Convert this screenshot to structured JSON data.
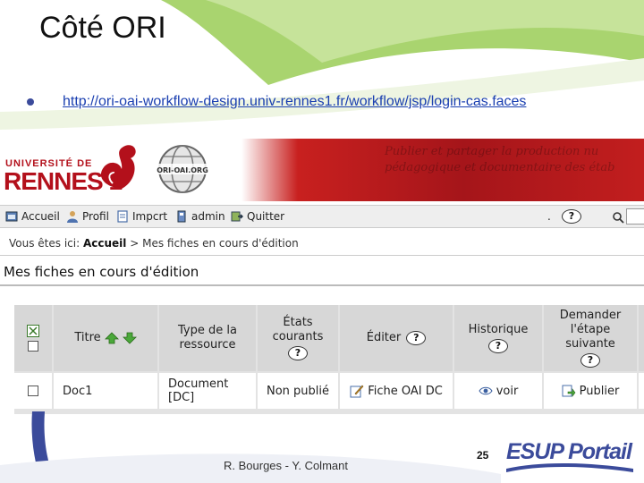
{
  "slide": {
    "title": "Côté ORI",
    "link": "http://ori-oai-workflow-design.univ-rennes1.fr/workflow/jsp/login-cas.faces",
    "footer_author": "R. Bourges - Y. Colmant",
    "page_number": "25",
    "footer_logo": "ESUP Portail",
    "colors": {
      "accent_green": "#8dc63f",
      "link_blue": "#1a3fb0",
      "brand_red": "#b3101b"
    }
  },
  "banner": {
    "univ_line1": "UNIVERSITÉ DE",
    "univ_line2": "RENNES 1",
    "orioai_logo": "ORI-OAI.ORG",
    "tagline_line1": "Publier et partager la production nu",
    "tagline_line2": "pédagogique et documentaire des étab"
  },
  "menu": {
    "items": [
      {
        "label": "Accueil",
        "icon": "home-icon"
      },
      {
        "label": "Profil",
        "icon": "user-icon"
      },
      {
        "label": "Impcrt",
        "icon": "import-icon"
      },
      {
        "label": "admin",
        "icon": "admin-icon"
      },
      {
        "label": "Quitter",
        "icon": "quit-icon"
      }
    ],
    "dot": ".",
    "help": "?"
  },
  "breadcrumb": {
    "prefix": "Vous êtes ici:",
    "home": "Accueil",
    "current": "> Mes fiches en cours d'édition"
  },
  "page_title": "Mes fiches en cours d'édition",
  "table": {
    "headers": {
      "titre": "Titre",
      "type": "Type de la ressource",
      "etats": "États courants",
      "editer": "Éditer",
      "historique": "Historique",
      "demander": "Demander l'étape suivante"
    },
    "row": {
      "titre": "Doc1",
      "type": "Document [DC]",
      "etat": "Non publié",
      "editer": "Fiche OAI DC",
      "historique": "voir",
      "action": "Publier"
    }
  }
}
